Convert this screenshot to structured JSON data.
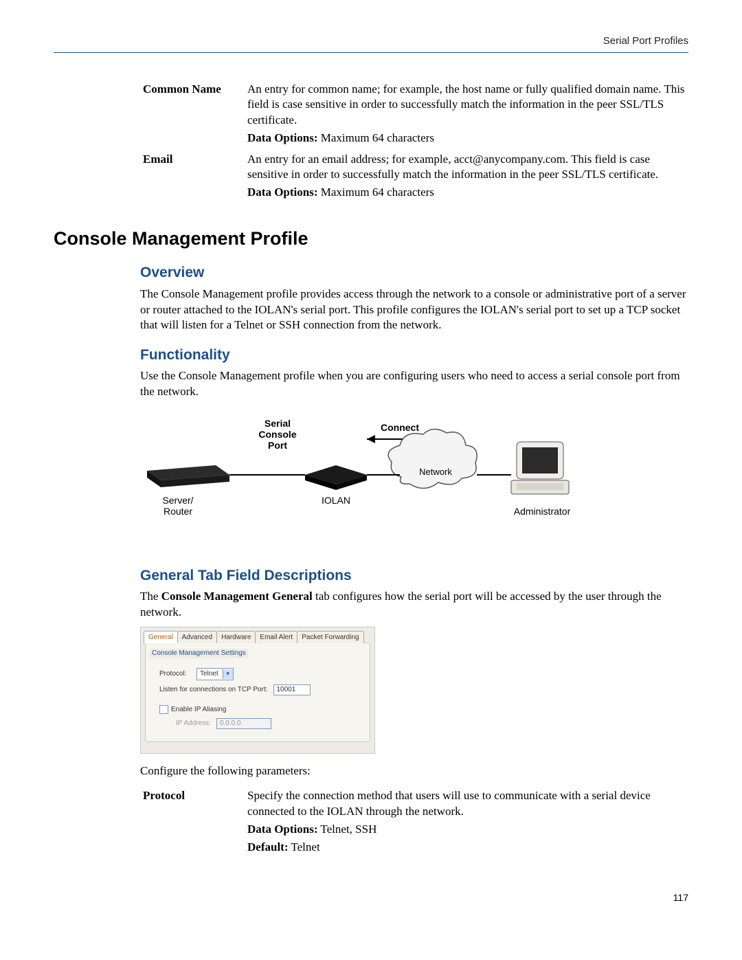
{
  "header": {
    "breadcrumb": "Serial Port Profiles"
  },
  "defs_top": [
    {
      "term": "Common Name",
      "desc": "An entry for common name; for example, the host name or fully qualified domain name. This field is case sensitive in order to successfully match the information in the peer SSL/TLS certificate.",
      "data_options_label": "Data Options:",
      "data_options_value": " Maximum 64 characters"
    },
    {
      "term": "Email",
      "desc": "An entry for an email address; for example, acct@anycompany.com. This field is case sensitive in order to successfully match the information in the peer SSL/TLS certificate.",
      "data_options_label": "Data Options:",
      "data_options_value": " Maximum 64 characters"
    }
  ],
  "section_title": "Console Management Profile",
  "overview": {
    "heading": "Overview",
    "text": "The Console Management profile provides access through the network to a console or administrative port of a server or router attached to the IOLAN's serial port. This profile configures the IOLAN's serial port to set up a TCP socket that will listen for a Telnet or SSH connection from the network."
  },
  "functionality": {
    "heading": "Functionality",
    "text": "Use the Console Management profile when you are configuring users who need to access a serial console port from the network."
  },
  "diagram": {
    "labels": {
      "serial_console_port": "Serial\nConsole\nPort",
      "connect": "Connect",
      "network": "Network",
      "server_router": "Server/\nRouter",
      "iolan": "IOLAN",
      "administrator": "Administrator"
    }
  },
  "general_tab": {
    "heading": "General Tab Field Descriptions",
    "intro_pre": "The ",
    "intro_bold": "Console Management General",
    "intro_post": " tab configures how the serial port will be accessed by the user through the network.",
    "ui": {
      "tabs": [
        "General",
        "Advanced",
        "Hardware",
        "Email Alert",
        "Packet Forwarding"
      ],
      "group_title": "Console Management Settings",
      "protocol_label": "Protocol:",
      "protocol_value": "Telnet",
      "listen_label": "Listen for connections on TCP Port:",
      "listen_value": "10001",
      "enable_ip_aliasing": "Enable IP Aliasing",
      "ip_address_label": "IP Address:",
      "ip_address_value": "0.0.0.0"
    },
    "configure_text": "Configure the following parameters:"
  },
  "defs_bottom": [
    {
      "term": "Protocol",
      "desc": "Specify the connection method that users will use to communicate with a serial device connected to the IOLAN through the network.",
      "data_options_label": "Data Options:",
      "data_options_value": " Telnet, SSH",
      "default_label": "Default:",
      "default_value": " Telnet"
    }
  ],
  "page_number": "117"
}
